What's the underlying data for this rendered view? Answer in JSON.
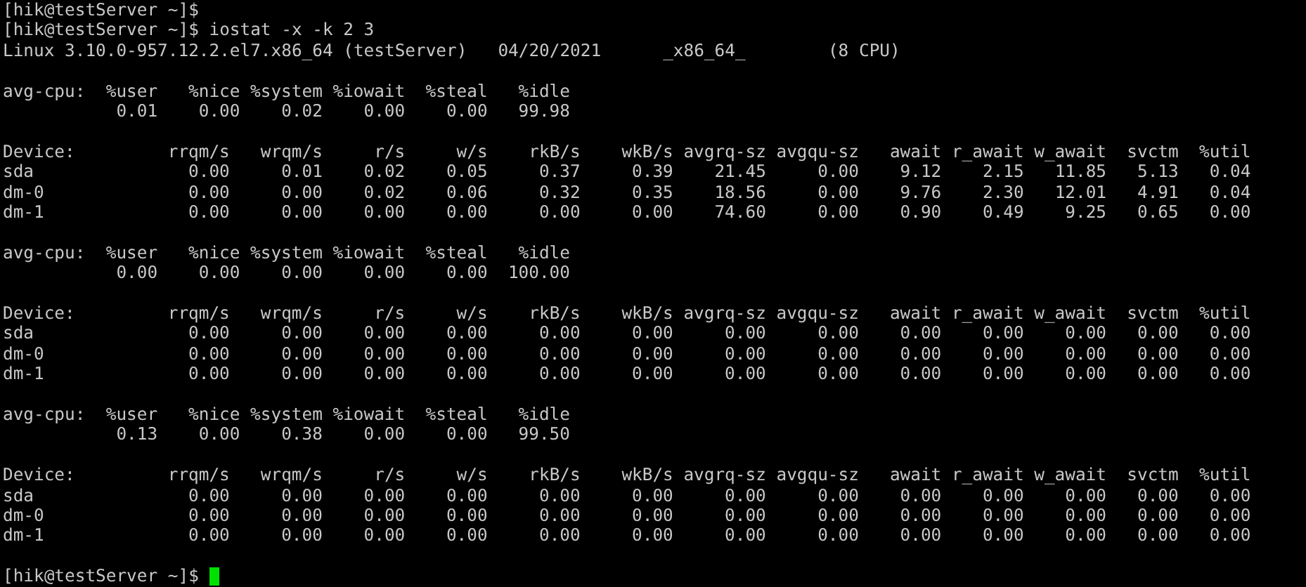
{
  "previous_prompt": "[hik@testServer ~]$",
  "command_line": "[hik@testServer ~]$ iostat -x -k 2 3",
  "system_info": [
    "Linux 3.10.0-957.12.2.el7.x86_64 (testServer)",
    "04/20/2021",
    "_x86_64_",
    "(8 CPU)"
  ],
  "reports": [
    {
      "cpu": {
        "label": "avg-cpu:",
        "columns": [
          "%user",
          "%nice",
          "%system",
          "%iowait",
          "%steal",
          "%idle"
        ],
        "values": [
          "0.01",
          "0.00",
          "0.02",
          "0.00",
          "0.00",
          "99.98"
        ]
      },
      "devices": {
        "columns": [
          "Device:",
          "rrqm/s",
          "wrqm/s",
          "r/s",
          "w/s",
          "rkB/s",
          "wkB/s",
          "avgrq-sz",
          "avgqu-sz",
          "await",
          "r_await",
          "w_await",
          "svctm",
          "%util"
        ],
        "rows": [
          [
            "sda",
            "0.00",
            "0.01",
            "0.02",
            "0.05",
            "0.37",
            "0.39",
            "21.45",
            "0.00",
            "9.12",
            "2.15",
            "11.85",
            "5.13",
            "0.04"
          ],
          [
            "dm-0",
            "0.00",
            "0.00",
            "0.02",
            "0.06",
            "0.32",
            "0.35",
            "18.56",
            "0.00",
            "9.76",
            "2.30",
            "12.01",
            "4.91",
            "0.04"
          ],
          [
            "dm-1",
            "0.00",
            "0.00",
            "0.00",
            "0.00",
            "0.00",
            "0.00",
            "74.60",
            "0.00",
            "0.90",
            "0.49",
            "9.25",
            "0.65",
            "0.00"
          ]
        ]
      }
    },
    {
      "cpu": {
        "label": "avg-cpu:",
        "columns": [
          "%user",
          "%nice",
          "%system",
          "%iowait",
          "%steal",
          "%idle"
        ],
        "values": [
          "0.00",
          "0.00",
          "0.00",
          "0.00",
          "0.00",
          "100.00"
        ]
      },
      "devices": {
        "columns": [
          "Device:",
          "rrqm/s",
          "wrqm/s",
          "r/s",
          "w/s",
          "rkB/s",
          "wkB/s",
          "avgrq-sz",
          "avgqu-sz",
          "await",
          "r_await",
          "w_await",
          "svctm",
          "%util"
        ],
        "rows": [
          [
            "sda",
            "0.00",
            "0.00",
            "0.00",
            "0.00",
            "0.00",
            "0.00",
            "0.00",
            "0.00",
            "0.00",
            "0.00",
            "0.00",
            "0.00",
            "0.00"
          ],
          [
            "dm-0",
            "0.00",
            "0.00",
            "0.00",
            "0.00",
            "0.00",
            "0.00",
            "0.00",
            "0.00",
            "0.00",
            "0.00",
            "0.00",
            "0.00",
            "0.00"
          ],
          [
            "dm-1",
            "0.00",
            "0.00",
            "0.00",
            "0.00",
            "0.00",
            "0.00",
            "0.00",
            "0.00",
            "0.00",
            "0.00",
            "0.00",
            "0.00",
            "0.00"
          ]
        ]
      }
    },
    {
      "cpu": {
        "label": "avg-cpu:",
        "columns": [
          "%user",
          "%nice",
          "%system",
          "%iowait",
          "%steal",
          "%idle"
        ],
        "values": [
          "0.13",
          "0.00",
          "0.38",
          "0.00",
          "0.00",
          "99.50"
        ]
      },
      "devices": {
        "columns": [
          "Device:",
          "rrqm/s",
          "wrqm/s",
          "r/s",
          "w/s",
          "rkB/s",
          "wkB/s",
          "avgrq-sz",
          "avgqu-sz",
          "await",
          "r_await",
          "w_await",
          "svctm",
          "%util"
        ],
        "rows": [
          [
            "sda",
            "0.00",
            "0.00",
            "0.00",
            "0.00",
            "0.00",
            "0.00",
            "0.00",
            "0.00",
            "0.00",
            "0.00",
            "0.00",
            "0.00",
            "0.00"
          ],
          [
            "dm-0",
            "0.00",
            "0.00",
            "0.00",
            "0.00",
            "0.00",
            "0.00",
            "0.00",
            "0.00",
            "0.00",
            "0.00",
            "0.00",
            "0.00",
            "0.00"
          ],
          [
            "dm-1",
            "0.00",
            "0.00",
            "0.00",
            "0.00",
            "0.00",
            "0.00",
            "0.00",
            "0.00",
            "0.00",
            "0.00",
            "0.00",
            "0.00",
            "0.00"
          ]
        ]
      }
    }
  ],
  "prompt": "[hik@testServer ~]$"
}
